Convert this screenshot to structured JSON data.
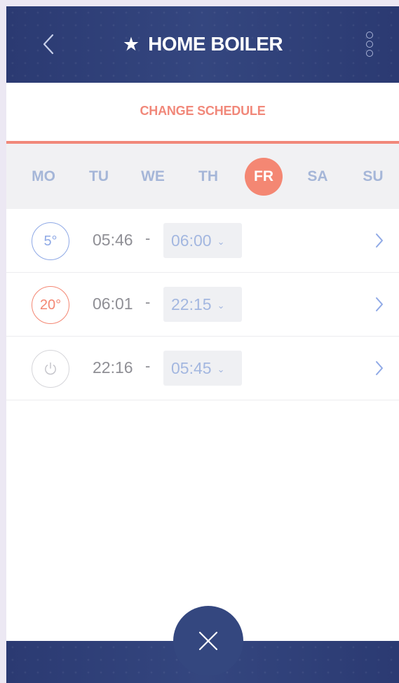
{
  "header": {
    "title": "HOME BOILER",
    "star": "★",
    "back_icon": "chevron-left-icon",
    "menu_icon": "more-vertical-icon"
  },
  "subtitle": "CHANGE SCHEDULE",
  "days": [
    {
      "label": "MO",
      "active": false
    },
    {
      "label": "TU",
      "active": false
    },
    {
      "label": "WE",
      "active": false
    },
    {
      "label": "TH",
      "active": false
    },
    {
      "label": "FR",
      "active": true
    },
    {
      "label": "SA",
      "active": false
    },
    {
      "label": "SU",
      "active": false
    }
  ],
  "schedule": [
    {
      "mode": "5°",
      "mode_icon": "low-temp-icon",
      "color": "#8fa9e6",
      "start": "05:46",
      "separator": "-",
      "end": "06:00"
    },
    {
      "mode": "20°",
      "mode_icon": "high-temp-icon",
      "color": "#f48773",
      "start": "06:01",
      "separator": "-",
      "end": "22:15"
    },
    {
      "mode": "",
      "mode_icon": "power-icon",
      "color": "#d6d6da",
      "start": "22:16",
      "separator": "-",
      "end": "05:45"
    }
  ],
  "colors": {
    "header_bg": "#2f3f78",
    "accent": "#f1887a",
    "day_inactive": "#a5b6d8",
    "select_text": "#a3b7e0"
  },
  "close_icon": "close-icon"
}
